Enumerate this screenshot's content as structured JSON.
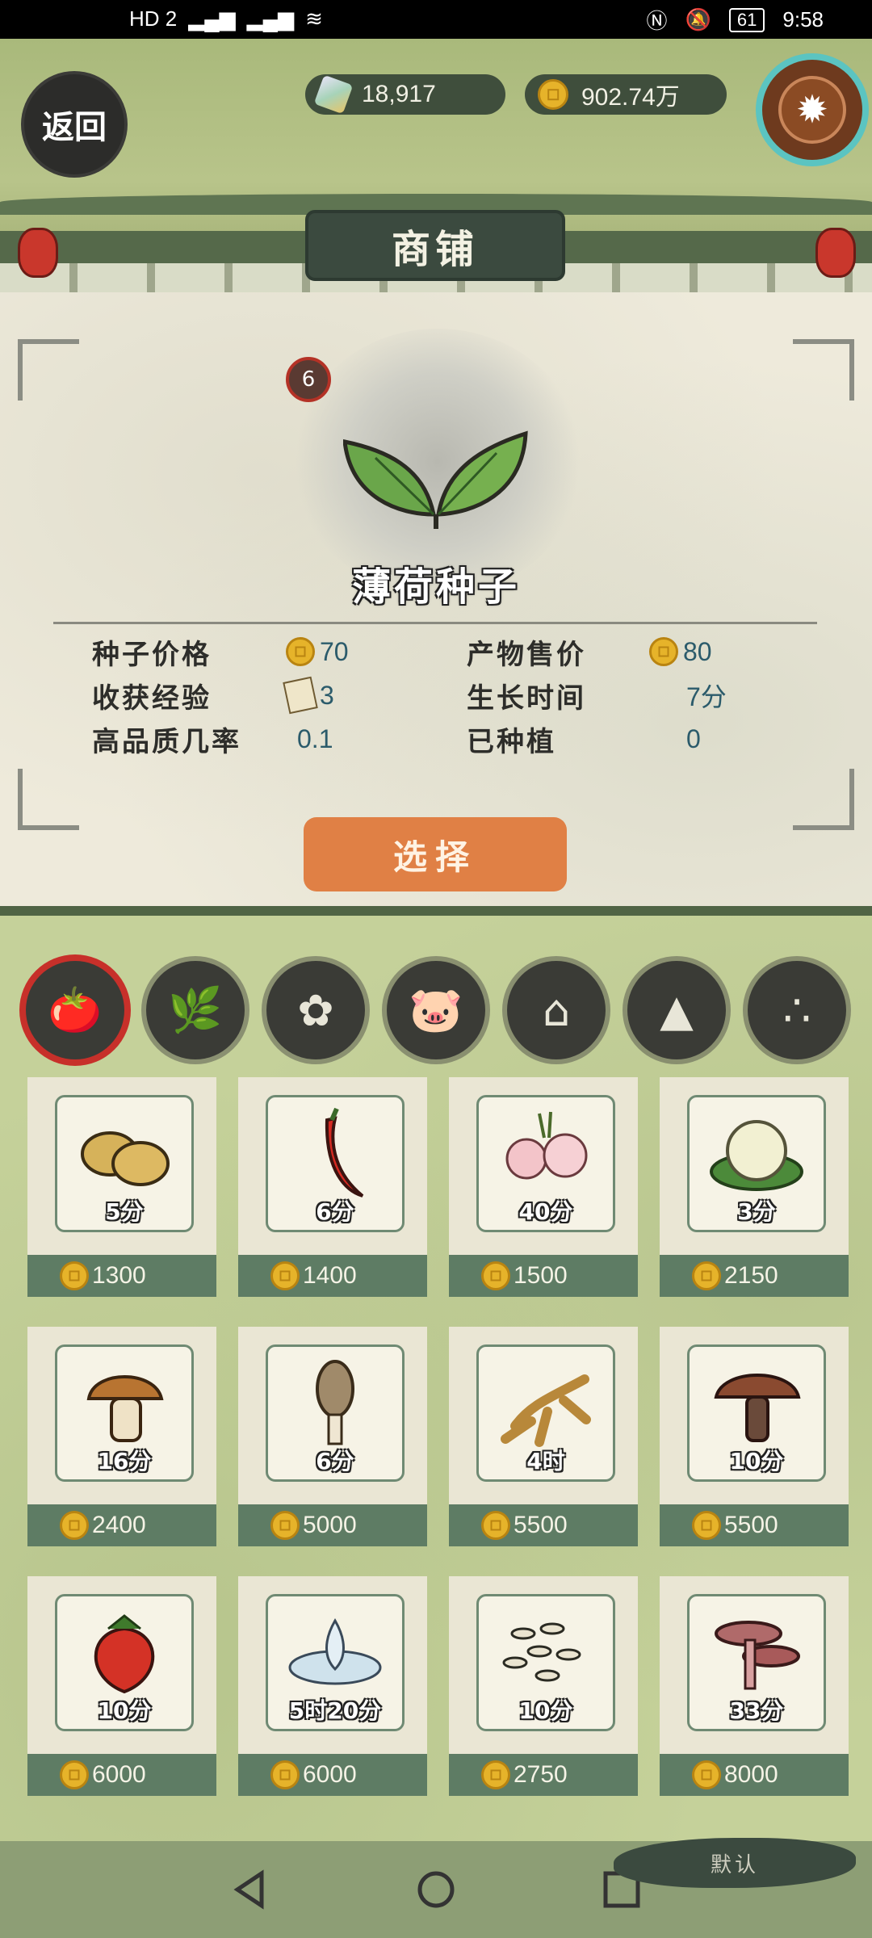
{
  "status_bar": {
    "network": "HD 2",
    "signal1": "4G",
    "signal2": "4G",
    "battery": "61",
    "time": "9:58"
  },
  "header": {
    "back_label": "返回",
    "gems": "18,917",
    "coins": "902.74万",
    "title": "商铺"
  },
  "selected_seed": {
    "level": "6",
    "name": "薄荷种子",
    "stats": [
      {
        "label": "种子价格",
        "value": "70",
        "icon": "coin"
      },
      {
        "label": "收获经验",
        "value": "3",
        "icon": "scroll"
      },
      {
        "label": "高品质几率",
        "value": "0.1",
        "icon": ""
      },
      {
        "label": "产物售价",
        "value": "80",
        "icon": "coin"
      },
      {
        "label": "生长时间",
        "value": "7分",
        "icon": ""
      },
      {
        "label": "已种植",
        "value": "0",
        "icon": ""
      }
    ],
    "select_label": "选择"
  },
  "category_tabs": [
    {
      "icon": "vegetable-icon",
      "glyph": "🍅",
      "active": true
    },
    {
      "icon": "herb-icon",
      "glyph": "🌿",
      "active": false
    },
    {
      "icon": "flower-icon",
      "glyph": "✿",
      "active": false
    },
    {
      "icon": "pig-icon",
      "glyph": "🐷",
      "active": false
    },
    {
      "icon": "house-icon",
      "glyph": "⌂",
      "active": false
    },
    {
      "icon": "mountain-icon",
      "glyph": "▲",
      "active": false
    },
    {
      "icon": "seeds-icon",
      "glyph": "∴",
      "active": false
    }
  ],
  "items": [
    {
      "name": "potato",
      "time": "5分",
      "price": "1300"
    },
    {
      "name": "chili",
      "time": "6分",
      "price": "1400"
    },
    {
      "name": "pink-flower",
      "time": "40分",
      "price": "1500"
    },
    {
      "name": "cauliflower",
      "time": "3分",
      "price": "2150"
    },
    {
      "name": "brown-mushroom",
      "time": "16分",
      "price": "2400"
    },
    {
      "name": "morel",
      "time": "6分",
      "price": "5000"
    },
    {
      "name": "ginseng",
      "time": "4时",
      "price": "5500"
    },
    {
      "name": "dark-mushroom",
      "time": "10分",
      "price": "5500"
    },
    {
      "name": "strawberry",
      "time": "10分",
      "price": "6000"
    },
    {
      "name": "lotus",
      "time": "5时20分",
      "price": "6000"
    },
    {
      "name": "rice-seeds",
      "time": "10分",
      "price": "2750"
    },
    {
      "name": "lingzhi",
      "time": "33分",
      "price": "8000"
    }
  ],
  "footer": {
    "default_label": "默认"
  },
  "colors": {
    "accent": "#e08045",
    "panel": "#3b4a3f",
    "price_bar": "#5e7c64",
    "active_ring": "#c7302a"
  }
}
